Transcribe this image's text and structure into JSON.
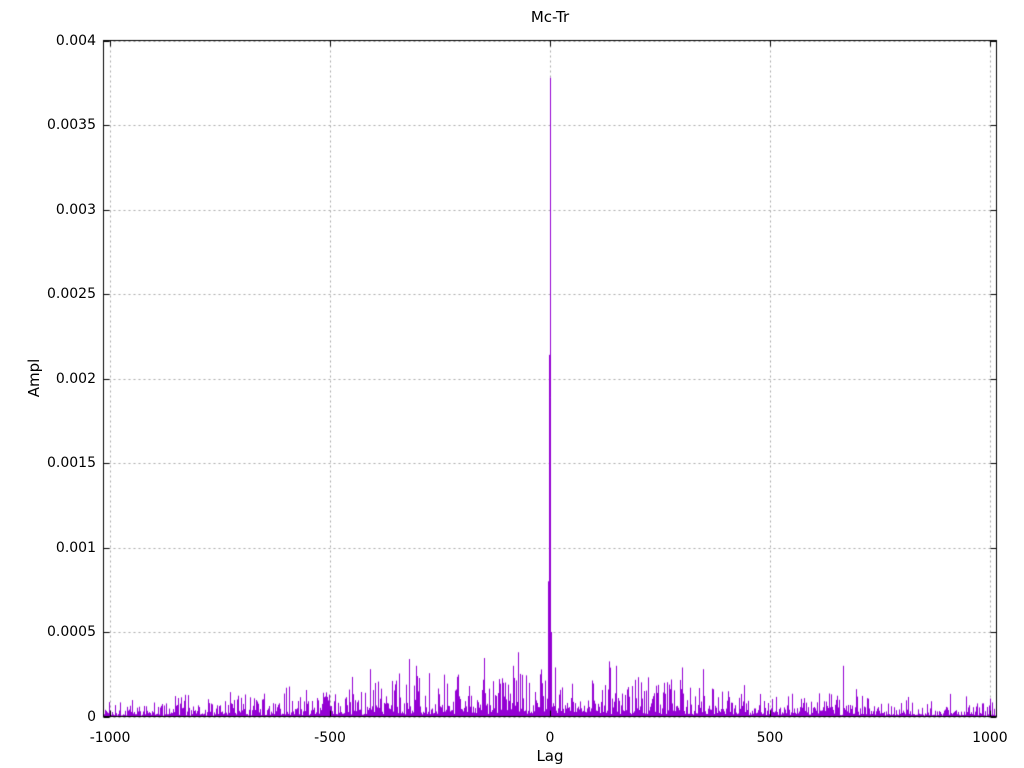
{
  "page": {
    "background_color": "#ffffff",
    "text_color": "#000000"
  },
  "chart_data": {
    "type": "line",
    "plot_style": "cross-correlation trace: dominant spike at lag 0 over a low noise floor",
    "title": "Mc-Tr",
    "xlabel": "Lag",
    "ylabel": "Ampl",
    "xlim": [
      -1015,
      1015
    ],
    "ylim": [
      0,
      0.004
    ],
    "xticks": [
      -1000,
      -500,
      0,
      500,
      1000
    ],
    "xtick_labels": [
      "-1000",
      "-500",
      "0",
      "500",
      "1000"
    ],
    "yticks": [
      0,
      0.0005,
      0.001,
      0.0015,
      0.002,
      0.0025,
      0.003,
      0.0035,
      0.004
    ],
    "ytick_labels": [
      "0",
      "0.0005",
      "0.001",
      "0.0015",
      "0.002",
      "0.0025",
      "0.003",
      "0.0035",
      "0.004"
    ],
    "grid": true,
    "grid_style": "dotted",
    "legend": "none",
    "line_color": "#9400d3",
    "grid_color": "#a8a8a8",
    "frame_color": "#000000",
    "peak_points": [
      {
        "x": -4,
        "y": 0.0008
      },
      {
        "x": -2,
        "y": 0.00214
      },
      {
        "x": 0,
        "y": 0.00378
      },
      {
        "x": 2,
        "y": 0.0005
      }
    ],
    "extra_spikes": [
      {
        "x": -410,
        "y": 0.00028
      },
      {
        "x": -320,
        "y": 0.00034
      },
      {
        "x": -305,
        "y": 0.0003
      },
      {
        "x": -85,
        "y": 0.0003
      },
      {
        "x": 150,
        "y": 0.0003
      },
      {
        "x": 300,
        "y": 0.00029
      },
      {
        "x": 348,
        "y": 0.00028
      },
      {
        "x": 665,
        "y": 0.0003
      }
    ],
    "noise": {
      "seed": 1337,
      "base": 5e-05,
      "center_boost": 0.00013,
      "shape_exp": 1.8,
      "burst_prob": 0.03,
      "burst_gain": 1.5,
      "max_value": 0.00038
    }
  }
}
